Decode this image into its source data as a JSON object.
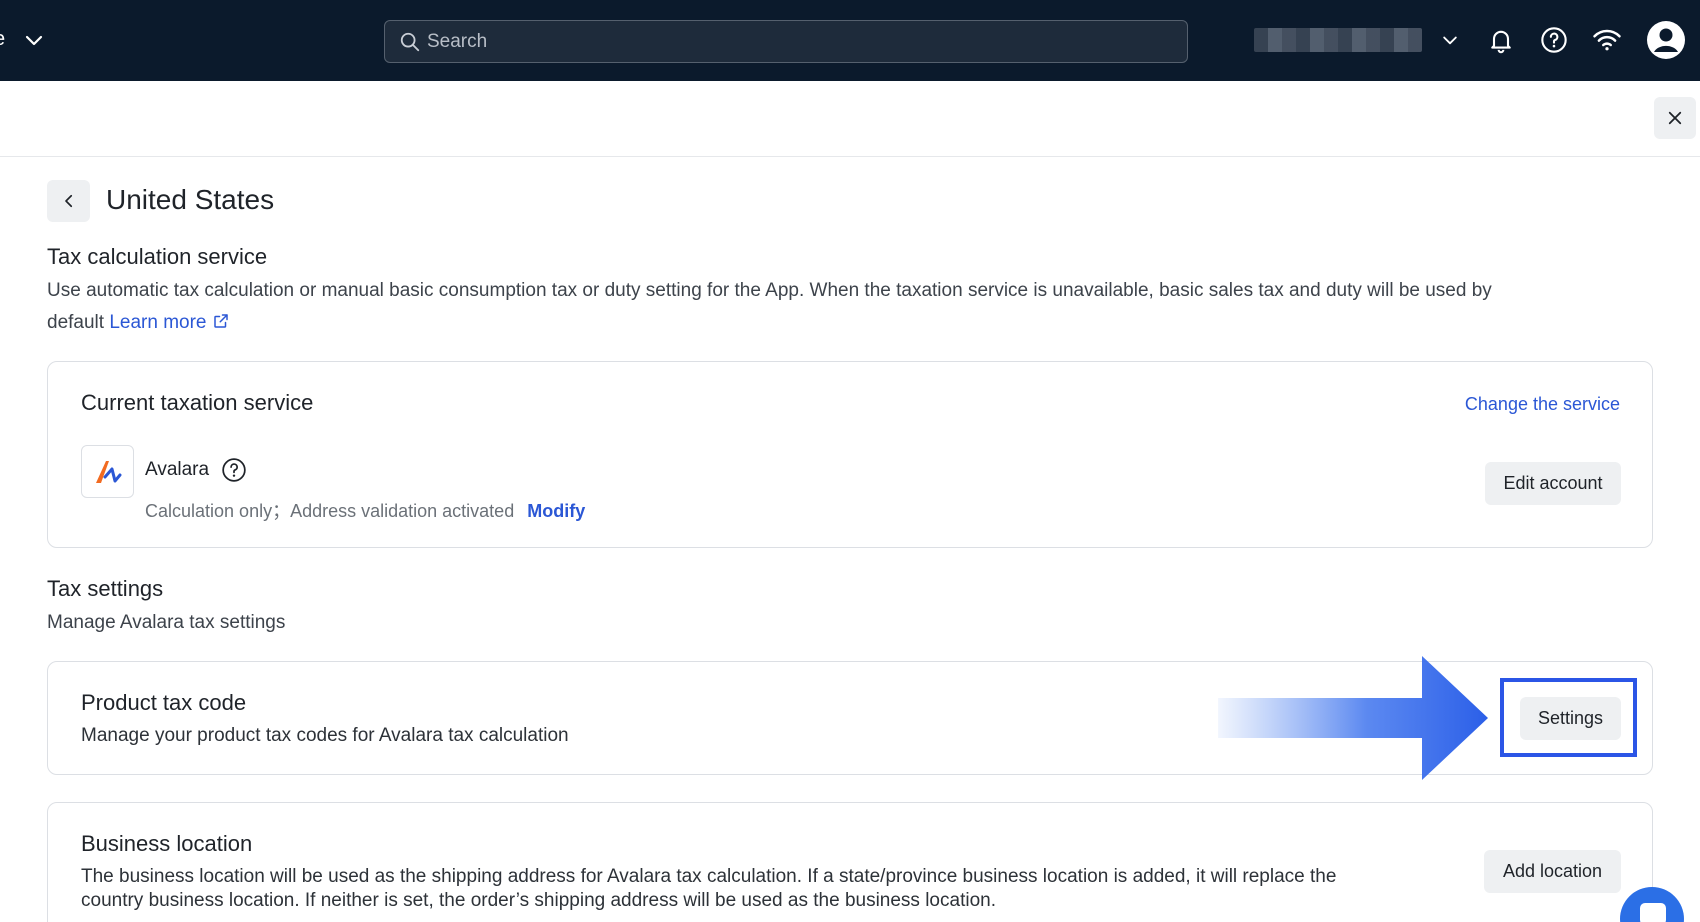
{
  "topbar": {
    "search_placeholder": "Search",
    "icons": [
      "chevron-down-icon",
      "search-icon",
      "bell-icon",
      "help-icon",
      "wifi-icon",
      "user-icon"
    ]
  },
  "page": {
    "title": "United States"
  },
  "tax_calc": {
    "title": "Tax calculation service",
    "desc": "Use automatic tax calculation or manual basic consumption tax or duty setting for the App. When the taxation service is unavailable, basic sales tax and duty will be used by",
    "desc_line2": "default",
    "learn_more": "Learn more"
  },
  "current_service": {
    "title": "Current taxation service",
    "change_link": "Change the service",
    "provider": "Avalara",
    "status": "Calculation only；Address validation activated",
    "modify": "Modify",
    "edit_account": "Edit account"
  },
  "tax_settings": {
    "title": "Tax settings",
    "desc": "Manage Avalara tax settings"
  },
  "product_tax_code": {
    "title": "Product tax code",
    "desc": "Manage your product tax codes for Avalara tax calculation",
    "button": "Settings"
  },
  "business_location": {
    "title": "Business location",
    "desc_line1": "The business location will be used as the shipping address for Avalara tax calculation. If a state/province business location is added, it will replace the",
    "desc_line2": "country business location. If neither is set, the order’s shipping address will be used as the business location.",
    "button": "Add location"
  },
  "colors": {
    "topbar": "#0b1a2c",
    "link": "#2b57d5",
    "highlight": "#2b55e6",
    "avalara_orange": "#f26b21"
  }
}
